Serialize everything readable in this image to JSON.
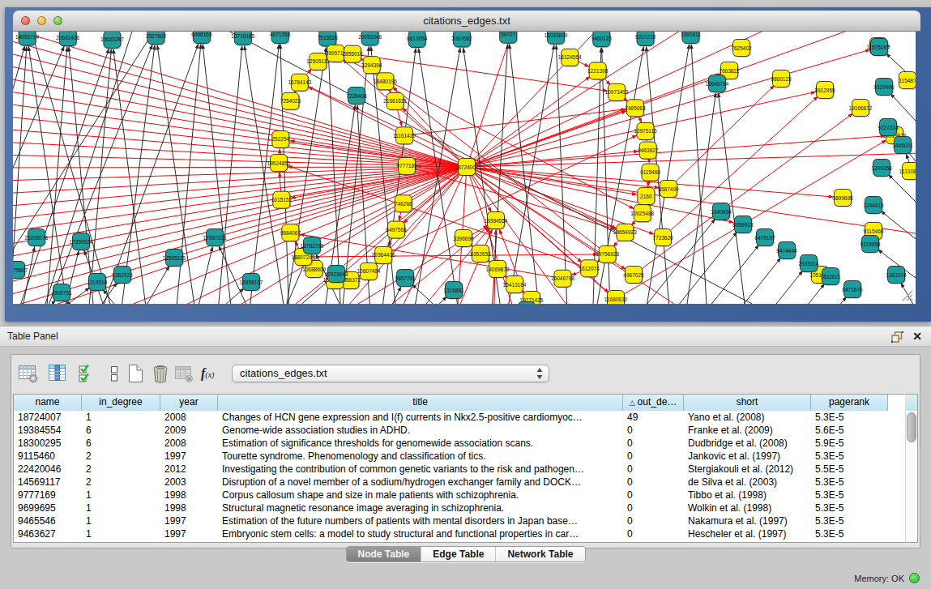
{
  "window": {
    "title": "citations_edges.txt",
    "traffic_lights": [
      "close",
      "minimize",
      "zoom"
    ]
  },
  "graph": {
    "background": "#ffffff",
    "node_color_yellow": "#ffee00",
    "node_color_teal": "#1d9e9e",
    "edge_color_red": "#fb0007",
    "edge_color_black": "#2a2a2a",
    "hub_label": "18724007",
    "highlight_label": "19384554",
    "lone_node_label": "16648784",
    "top_row_labels": [
      "14055714",
      "20691406",
      "10653287",
      "1527602",
      "6466163",
      "10719185",
      "4671358",
      "7515526",
      "20053346",
      "8813054",
      "2087682",
      "5972?",
      "16033809",
      "9460123"
    ],
    "ring_labels": [
      "9777169",
      "746266",
      "6497568",
      "20364416",
      "10607484",
      "7986372",
      "15720407",
      "10688609",
      "18807249",
      "9884067",
      "1615152",
      "19524851",
      "252254",
      "7254023",
      "16784143",
      "12505115",
      "8995718",
      "2855010"
    ],
    "arc_labels": [
      "16124554",
      "1221398",
      "10973493",
      "7485063",
      "12975115",
      "9463627",
      "9115460",
      "2160",
      "10025488",
      "19654923",
      "19756928",
      "1612074",
      "16046798"
    ],
    "right_chain_labels": [
      "1640954",
      "8958923",
      "6479197",
      "9474444",
      "2935114",
      "7832621",
      "8471670"
    ],
    "right_column_labels": [
      "1575187",
      "9329966",
      "9227314",
      "1209358",
      "1244415",
      "9115958",
      "1283374",
      "1445021"
    ],
    "left_cluster_labels": [
      "23205076",
      "17359924",
      "10975887",
      "1114519",
      "12505115",
      "17957223",
      "16958107",
      "16782759",
      "12923448",
      "9857791",
      "1316881",
      "8850?1",
      "1215689"
    ],
    "scatter_labels": [
      "7663822",
      "9860123",
      "8912955",
      "19166872",
      "14919823",
      "7625402",
      "0899695",
      "9115460",
      "1051408",
      "11548?"
    ]
  },
  "table_panel": {
    "title": "Table Panel",
    "float_icon": "float-panel",
    "close_icon": "close-panel",
    "toolbar": {
      "icons": [
        "table-settings",
        "column-settings",
        "select-rows",
        "row-height",
        "new-table",
        "delete-table",
        "import-table-disabled",
        "function-builder"
      ],
      "function_label_f": "f",
      "function_label_x": "(x)",
      "table_select_value": "citations_edges.txt"
    },
    "table": {
      "columns": [
        "name",
        "in_degree",
        "year",
        "title",
        "out_de…",
        "short",
        "pagerank"
      ],
      "sort_indicator": "△",
      "sort_column": "out_de…",
      "rows": [
        {
          "name": "18724007",
          "in_degree": "1",
          "year": "2008",
          "title": "Changes of HCN gene expression and I(f) currents in Nkx2.5-positive cardiomyoc…",
          "out_degree": "49",
          "short": "Yano et al. (2008)",
          "pagerank": "5.3E-5"
        },
        {
          "name": "19384554",
          "in_degree": "6",
          "year": "2009",
          "title": "Genome-wide association studies in ADHD.",
          "out_degree": "0",
          "short": "Franke et al. (2009)",
          "pagerank": "5.6E-5"
        },
        {
          "name": "18300295",
          "in_degree": "6",
          "year": "2008",
          "title": "Estimation of significance thresholds for genomewide association scans.",
          "out_degree": "0",
          "short": "Dudbridge et al. (2008)",
          "pagerank": "5.9E-5"
        },
        {
          "name": "9115460",
          "in_degree": "2",
          "year": "1997",
          "title": "Tourette syndrome. Phenomenology and classification of tics.",
          "out_degree": "0",
          "short": "Jankovic et al. (1997)",
          "pagerank": "5.3E-5"
        },
        {
          "name": "22420046",
          "in_degree": "2",
          "year": "2012",
          "title": "Investigating the contribution of common genetic variants to the risk and pathogen…",
          "out_degree": "0",
          "short": "Stergiakouli et al. (2012)",
          "pagerank": "5.5E-5"
        },
        {
          "name": "14569117",
          "in_degree": "2",
          "year": "2003",
          "title": "Disruption of a novel member of a sodium/hydrogen exchanger family and DOCK…",
          "out_degree": "0",
          "short": "de Silva et al. (2003)",
          "pagerank": "5.3E-5"
        },
        {
          "name": "9777169",
          "in_degree": "1",
          "year": "1998",
          "title": "Corpus callosum shape and size in male patients with schizophrenia.",
          "out_degree": "0",
          "short": "Tibbo et al. (1998)",
          "pagerank": "5.3E-5"
        },
        {
          "name": "9699695",
          "in_degree": "1",
          "year": "1998",
          "title": "Structural magnetic resonance image averaging in schizophrenia.",
          "out_degree": "0",
          "short": "Wolkin et al. (1998)",
          "pagerank": "5.3E-5"
        },
        {
          "name": "9465546",
          "in_degree": "1",
          "year": "1997",
          "title": "Estimation of the future numbers of patients with mental disorders in Japan base…",
          "out_degree": "0",
          "short": "Nakamura et al. (1997)",
          "pagerank": "5.3E-5"
        },
        {
          "name": "9463627",
          "in_degree": "1",
          "year": "1997",
          "title": "Embryonic stem cells: a model to study structural and functional properties in car…",
          "out_degree": "0",
          "short": "Hescheler et al. (1997)",
          "pagerank": "5.3E-5"
        }
      ]
    },
    "tabs": {
      "items": [
        "Node Table",
        "Edge Table",
        "Network Table"
      ],
      "selected": "Node Table"
    }
  },
  "status_bar": {
    "memory_label": "Memory: OK"
  }
}
